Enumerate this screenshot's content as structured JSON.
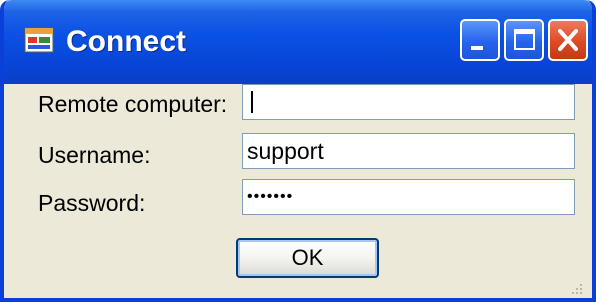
{
  "window": {
    "title": "Connect",
    "icon": "app-window-icon",
    "controls": [
      "minimize-icon",
      "maximize-icon",
      "close-icon"
    ],
    "accent_color": "#0a52e4",
    "close_color": "#dd4a24"
  },
  "form": {
    "remote_computer": {
      "label": "Remote computer:",
      "value": ""
    },
    "username": {
      "label": "Username:",
      "value": "support"
    },
    "password": {
      "label": "Password:",
      "value": "•••••••"
    }
  },
  "buttons": {
    "ok": "OK"
  }
}
